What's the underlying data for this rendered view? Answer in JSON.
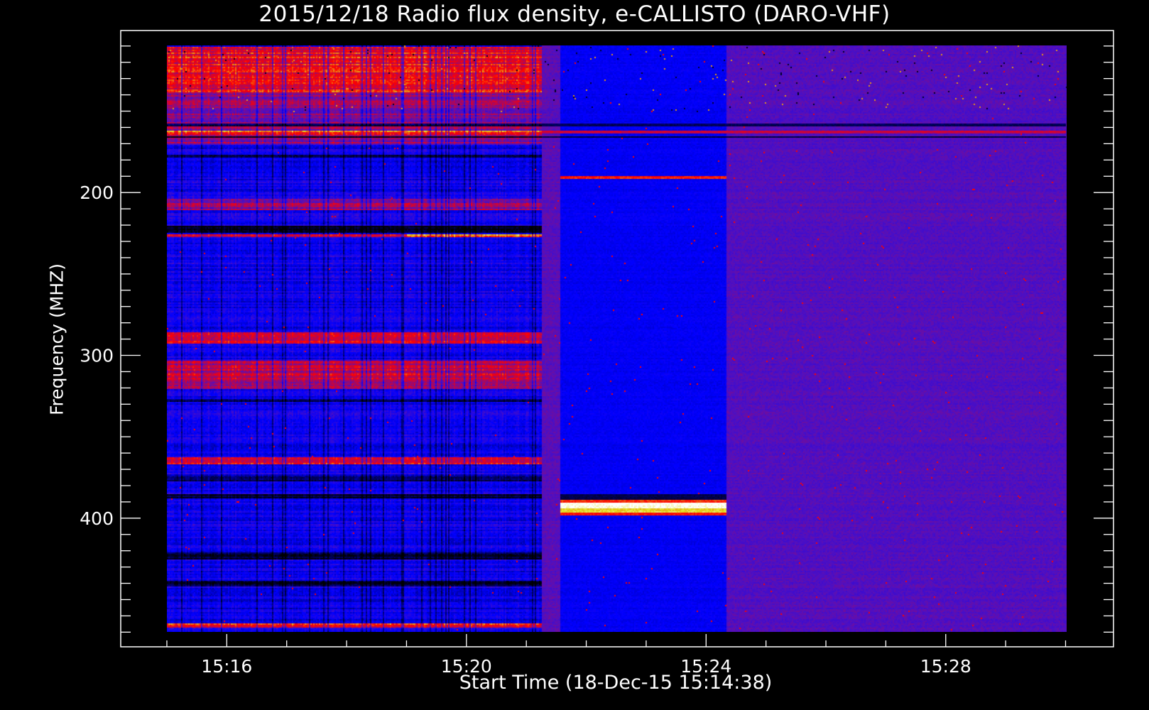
{
  "chart_data": {
    "type": "heatmap",
    "title": "2015/12/18  Radio flux density, e-CALLISTO (DARO-VHF)",
    "xlabel": "Start Time (18-Dec-15 15:14:38)",
    "ylabel": "Frequency (MHZ)",
    "x_unit": "minutes after 15:00",
    "xlim": [
      14.23,
      30.8
    ],
    "ylim": [
      479,
      100.5
    ],
    "y_inverted": true,
    "data_extent": {
      "time": [
        15.0,
        30.0
      ],
      "frequency": [
        109.5,
        470
      ]
    },
    "x_ticks": [
      {
        "value": 16,
        "label": "15:16"
      },
      {
        "value": 20,
        "label": "15:20"
      },
      {
        "value": 24,
        "label": "15:24"
      },
      {
        "value": 28,
        "label": "15:28"
      }
    ],
    "x_minor_step": 1,
    "y_ticks": [
      {
        "value": 200,
        "label": "200"
      },
      {
        "value": 300,
        "label": "300"
      },
      {
        "value": 400,
        "label": "400"
      }
    ],
    "y_minor_step": 10,
    "colormap": [
      "#000000",
      "#0000ff",
      "#5010c0",
      "#ff0000",
      "#e0e020",
      "#ffffff"
    ],
    "time_segments": [
      {
        "time": [
          15.0,
          21.25
        ],
        "base_level": 0.36,
        "style": "striped"
      },
      {
        "time": [
          21.25,
          21.56
        ],
        "base_level": 0.53,
        "style": "uniform"
      },
      {
        "time": [
          21.56,
          24.33
        ],
        "base_level": 0.34,
        "style": "uniform"
      },
      {
        "time": [
          24.33,
          30.0
        ],
        "base_level": 0.52,
        "style": "uniform"
      }
    ],
    "bands": [
      {
        "time": [
          15.0,
          21.25
        ],
        "freq": [
          110,
          138
        ],
        "level": 0.72
      },
      {
        "time": [
          15.0,
          21.25
        ],
        "freq": [
          138,
          170
        ],
        "level": 0.6
      },
      {
        "time": [
          15.0,
          30.0
        ],
        "freq": [
          157,
          159
        ],
        "level": 0.12
      },
      {
        "time": [
          15.0,
          21.25
        ],
        "freq": [
          161,
          164
        ],
        "level": 0.8
      },
      {
        "time": [
          21.25,
          30.0
        ],
        "freq": [
          161,
          163
        ],
        "level": 0.68
      },
      {
        "time": [
          15.0,
          30.0
        ],
        "freq": [
          165,
          166
        ],
        "level": 0.1
      },
      {
        "time": [
          15.0,
          21.25
        ],
        "freq": [
          176,
          178
        ],
        "level": 0.12
      },
      {
        "time": [
          15.0,
          21.25
        ],
        "freq": [
          203,
          210
        ],
        "level": 0.6
      },
      {
        "time": [
          21.56,
          24.33
        ],
        "freq": [
          189.5,
          191
        ],
        "level": 0.77
      },
      {
        "time": [
          15.0,
          21.25
        ],
        "freq": [
          220,
          224
        ],
        "level": 0.06
      },
      {
        "time": [
          15.0,
          21.25
        ],
        "freq": [
          225,
          227
        ],
        "level": 0.7
      },
      {
        "time": [
          19.0,
          21.25
        ],
        "freq": [
          225,
          227
        ],
        "level": 0.85
      },
      {
        "time": [
          15.0,
          21.25
        ],
        "freq": [
          285,
          292
        ],
        "level": 0.68
      },
      {
        "time": [
          15.0,
          21.25
        ],
        "freq": [
          303,
          320
        ],
        "level": 0.66
      },
      {
        "time": [
          15.0,
          21.25
        ],
        "freq": [
          326,
          328
        ],
        "level": 0.1
      },
      {
        "time": [
          15.0,
          21.25
        ],
        "freq": [
          362,
          366
        ],
        "level": 0.7
      },
      {
        "time": [
          15.0,
          21.25
        ],
        "freq": [
          373,
          377
        ],
        "level": 0.15
      },
      {
        "time": [
          15.0,
          21.25
        ],
        "freq": [
          385,
          387
        ],
        "level": 0.05
      },
      {
        "time": [
          21.56,
          24.33
        ],
        "freq": [
          385,
          388
        ],
        "level": 0.1
      },
      {
        "time": [
          21.56,
          24.33
        ],
        "freq": [
          388,
          390
        ],
        "level": 0.78
      },
      {
        "time": [
          21.56,
          24.33
        ],
        "freq": [
          390,
          393
        ],
        "level": 1.0
      },
      {
        "time": [
          21.56,
          24.33
        ],
        "freq": [
          393,
          396
        ],
        "level": 0.9
      },
      {
        "time": [
          21.56,
          24.33
        ],
        "freq": [
          396,
          397.5
        ],
        "level": 0.76
      },
      {
        "time": [
          15.0,
          21.25
        ],
        "freq": [
          420,
          425
        ],
        "level": 0.08
      },
      {
        "time": [
          15.0,
          21.25
        ],
        "freq": [
          438,
          441
        ],
        "level": 0.08
      },
      {
        "time": [
          15.0,
          21.25
        ],
        "freq": [
          447,
          462
        ],
        "level": 0.33
      },
      {
        "time": [
          15.0,
          21.25
        ],
        "freq": [
          464,
          467
        ],
        "level": 0.74
      }
    ]
  }
}
